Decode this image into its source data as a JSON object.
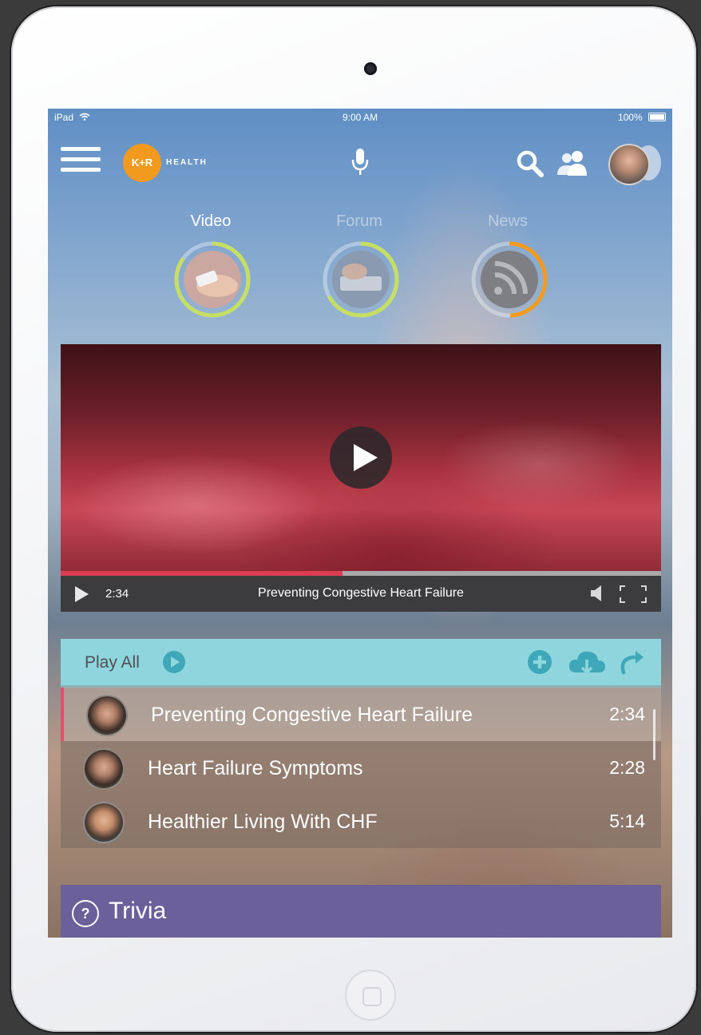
{
  "status_bar": {
    "device": "iPad",
    "time": "9:00 AM",
    "battery": "100%"
  },
  "header": {
    "logo_mark": "K+R",
    "logo_word": "HEALTH"
  },
  "tabs": [
    {
      "label": "Video"
    },
    {
      "label": "Forum"
    },
    {
      "label": "News"
    }
  ],
  "player": {
    "time": "2:34",
    "title": "Preventing Congestive Heart Failure",
    "progress": 0.47
  },
  "playlist": {
    "play_all": "Play All",
    "items": [
      {
        "title": "Preventing Congestive Heart Failure",
        "duration": "2:34"
      },
      {
        "title": "Heart Failure Symptoms",
        "duration": "2:28"
      },
      {
        "title": "Healthier Living With CHF",
        "duration": "5:14"
      }
    ]
  },
  "trivia": {
    "icon": "?",
    "label": "Trivia"
  },
  "colors": {
    "brand": "#f29a1e",
    "ring_green": "#c6df63",
    "ring_orange": "#f39a1f",
    "playlist_header": "#8fd5dd",
    "progress_red": "#dd3d52",
    "trivia": "#6b6099"
  }
}
